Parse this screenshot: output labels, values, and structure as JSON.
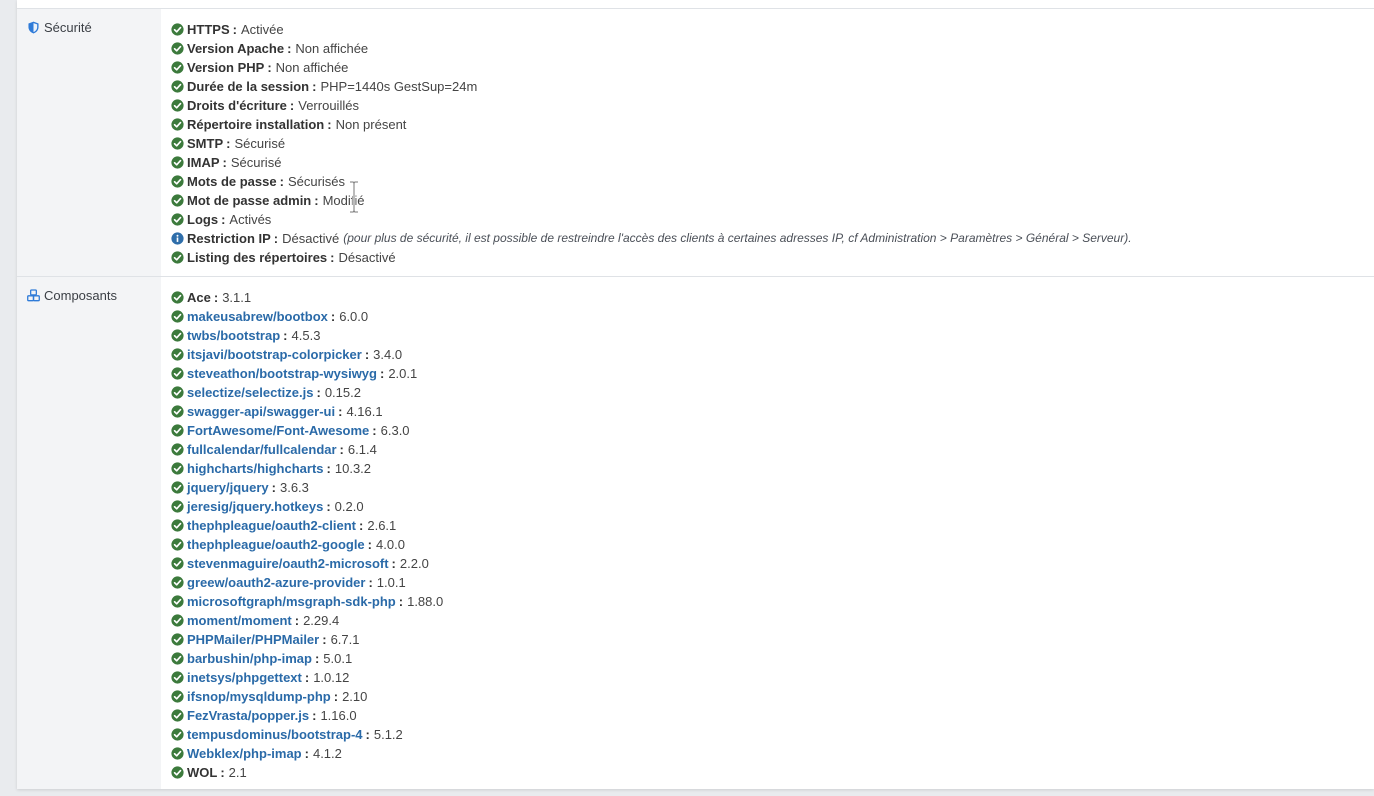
{
  "security": {
    "title": "Sécurité",
    "icon": "shield-icon",
    "items": [
      {
        "key": "HTTPS",
        "value": "Activée",
        "status": "ok"
      },
      {
        "key": "Version Apache",
        "value": "Non affichée",
        "status": "ok"
      },
      {
        "key": "Version PHP",
        "value": "Non affichée",
        "status": "ok"
      },
      {
        "key": "Durée de la session",
        "value": "PHP=1440s GestSup=24m",
        "status": "ok"
      },
      {
        "key": "Droits d'écriture",
        "value": "Verrouillés",
        "status": "ok"
      },
      {
        "key": "Répertoire installation",
        "value": "Non présent",
        "status": "ok"
      },
      {
        "key": "SMTP",
        "value": "Sécurisé",
        "status": "ok"
      },
      {
        "key": "IMAP",
        "value": "Sécurisé",
        "status": "ok"
      },
      {
        "key": "Mots de passe",
        "value": "Sécurisés",
        "status": "ok"
      },
      {
        "key": "Mot de passe admin",
        "value": "Modifié",
        "status": "ok"
      },
      {
        "key": "Logs",
        "value": "Activés",
        "status": "ok"
      },
      {
        "key": "Restriction IP",
        "value": "Désactivé",
        "status": "info",
        "note": "(pour plus de sécurité, il est possible de restreindre l'accès des clients à certaines adresses IP, cf Administration > Paramètres > Général > Serveur)."
      },
      {
        "key": "Listing des répertoires",
        "value": "Désactivé",
        "status": "ok"
      }
    ]
  },
  "components": {
    "title": "Composants",
    "icon": "cubes-icon",
    "items": [
      {
        "key": "Ace",
        "value": "3.1.1",
        "link": false
      },
      {
        "key": "makeusabrew/bootbox",
        "value": "6.0.0",
        "link": true
      },
      {
        "key": "twbs/bootstrap",
        "value": "4.5.3",
        "link": true
      },
      {
        "key": "itsjavi/bootstrap-colorpicker",
        "value": "3.4.0",
        "link": true
      },
      {
        "key": "steveathon/bootstrap-wysiwyg",
        "value": "2.0.1",
        "link": true
      },
      {
        "key": "selectize/selectize.js",
        "value": "0.15.2",
        "link": true
      },
      {
        "key": "swagger-api/swagger-ui",
        "value": "4.16.1",
        "link": true
      },
      {
        "key": "FortAwesome/Font-Awesome",
        "value": "6.3.0",
        "link": true
      },
      {
        "key": "fullcalendar/fullcalendar",
        "value": "6.1.4",
        "link": true
      },
      {
        "key": "highcharts/highcharts",
        "value": "10.3.2",
        "link": true
      },
      {
        "key": "jquery/jquery",
        "value": "3.6.3",
        "link": true
      },
      {
        "key": "jeresig/jquery.hotkeys",
        "value": "0.2.0",
        "link": true
      },
      {
        "key": "thephpleague/oauth2-client",
        "value": "2.6.1",
        "link": true
      },
      {
        "key": "thephpleague/oauth2-google",
        "value": "4.0.0",
        "link": true
      },
      {
        "key": "stevenmaguire/oauth2-microsoft",
        "value": "2.2.0",
        "link": true
      },
      {
        "key": "greew/oauth2-azure-provider",
        "value": "1.0.1",
        "link": true
      },
      {
        "key": "microsoftgraph/msgraph-sdk-php",
        "value": "1.88.0",
        "link": true
      },
      {
        "key": "moment/moment",
        "value": "2.29.4",
        "link": true
      },
      {
        "key": "PHPMailer/PHPMailer",
        "value": "6.7.1",
        "link": true
      },
      {
        "key": "barbushin/php-imap",
        "value": "5.0.1",
        "link": true
      },
      {
        "key": "inetsys/phpgettext",
        "value": "1.0.12",
        "link": true
      },
      {
        "key": "ifsnop/mysqldump-php",
        "value": "2.10",
        "link": true
      },
      {
        "key": "FezVrasta/popper.js",
        "value": "1.16.0",
        "link": true
      },
      {
        "key": "tempusdominus/bootstrap-4",
        "value": "5.1.2",
        "link": true
      },
      {
        "key": "Webklex/php-imap",
        "value": "4.1.2",
        "link": true
      },
      {
        "key": "WOL",
        "value": "2.1",
        "link": false
      }
    ]
  },
  "colors": {
    "ok": "#3c7a3c",
    "info": "#2f6eaa",
    "link": "#2a6aa8",
    "section_icon": "#2f7bd8"
  },
  "separator": ":"
}
